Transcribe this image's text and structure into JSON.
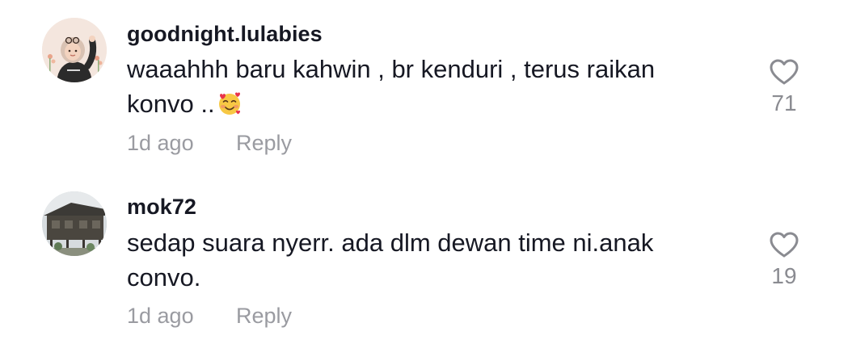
{
  "comments": [
    {
      "username": "goodnight.lulabies",
      "text_line1": "waaahhh baru kahwin , br kenduri , terus raikan",
      "text_line2": "konvo ..",
      "emoji": "smiling-face-with-hearts-icon",
      "time": "1d ago",
      "reply_label": "Reply",
      "likes": "71",
      "avatar": "cartoon-girl-hijab-avatar"
    },
    {
      "username": "mok72",
      "text_line1": "sedap suara nyerr. ada dlm dewan time ni.anak",
      "text_line2": "convo.",
      "time": "1d ago",
      "reply_label": "Reply",
      "likes": "19",
      "avatar": "wooden-house-photo-avatar"
    }
  ],
  "colors": {
    "username": "#161823",
    "text": "#161823",
    "meta": "#9a9ba1",
    "like_icon": "#8a8b91"
  }
}
